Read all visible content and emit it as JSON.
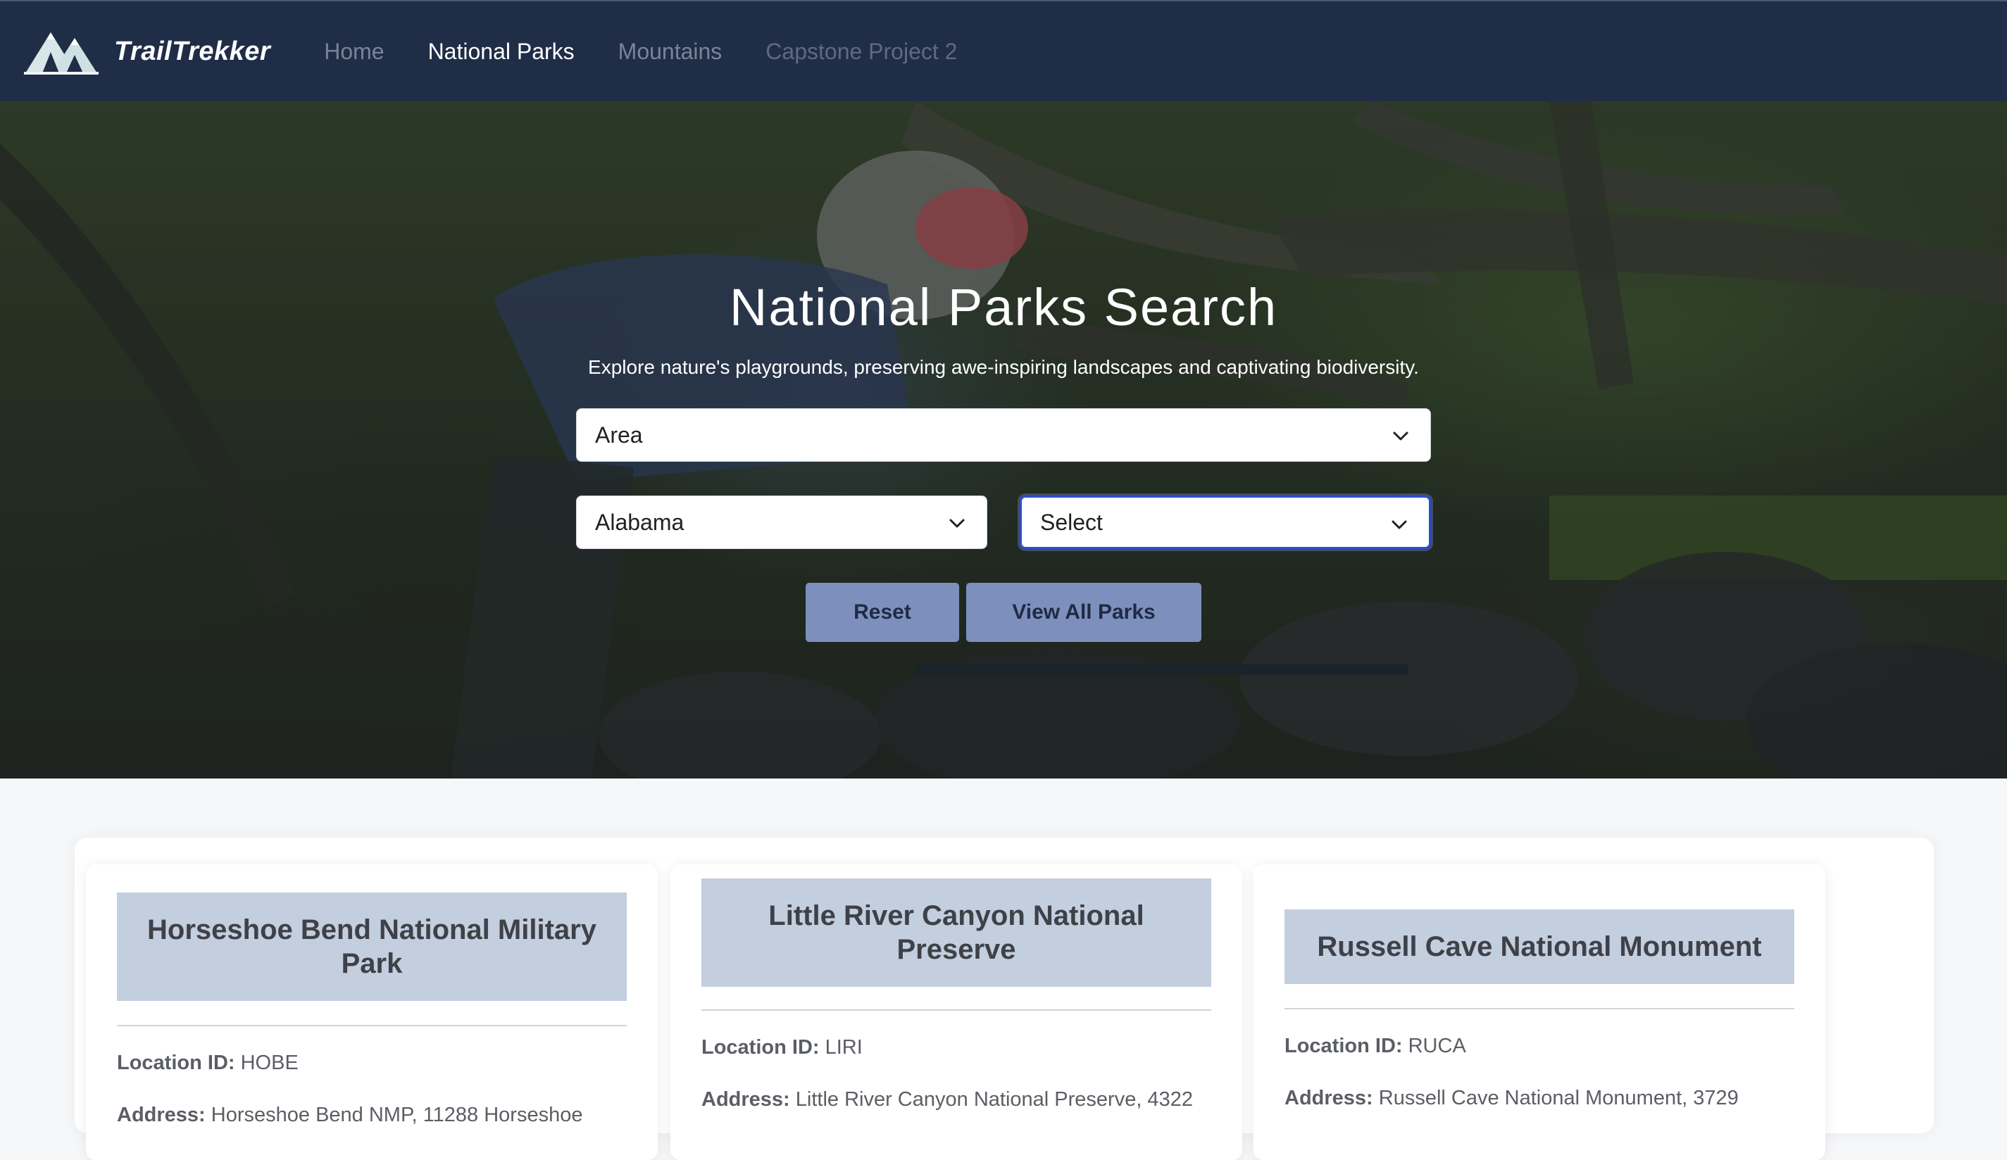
{
  "nav": {
    "brand": "TrailTrekker",
    "links": [
      {
        "label": "Home"
      },
      {
        "label": "National Parks"
      },
      {
        "label": "Mountains"
      },
      {
        "label": "Capstone Project 2"
      }
    ]
  },
  "hero": {
    "title": "National Parks Search",
    "subtitle": "Explore nature's playgrounds, preserving awe-inspiring landscapes and captivating biodiversity.",
    "area_select": "Area",
    "state_select": "Alabama",
    "park_select": "Select",
    "reset_label": "Reset",
    "view_all_label": "View All Parks"
  },
  "results": [
    {
      "name": "Horseshoe Bend National Military Park",
      "location_label": "Location ID:",
      "location_id": "HOBE",
      "address_label": "Address:",
      "address": "Horseshoe Bend NMP, 11288 Horseshoe"
    },
    {
      "name": "Little River Canyon National Preserve",
      "location_label": "Location ID:",
      "location_id": "LIRI",
      "address_label": "Address:",
      "address": "Little River Canyon National Preserve, 4322"
    },
    {
      "name": "Russell Cave National Monument",
      "location_label": "Location ID:",
      "location_id": "RUCA",
      "address_label": "Address:",
      "address": "Russell Cave National Monument, 3729"
    }
  ],
  "colors": {
    "navbar": "#1f2d47",
    "button": "#7d8fbd",
    "card_header": "#c3cede",
    "focus_ring": "#2b4fc7"
  }
}
